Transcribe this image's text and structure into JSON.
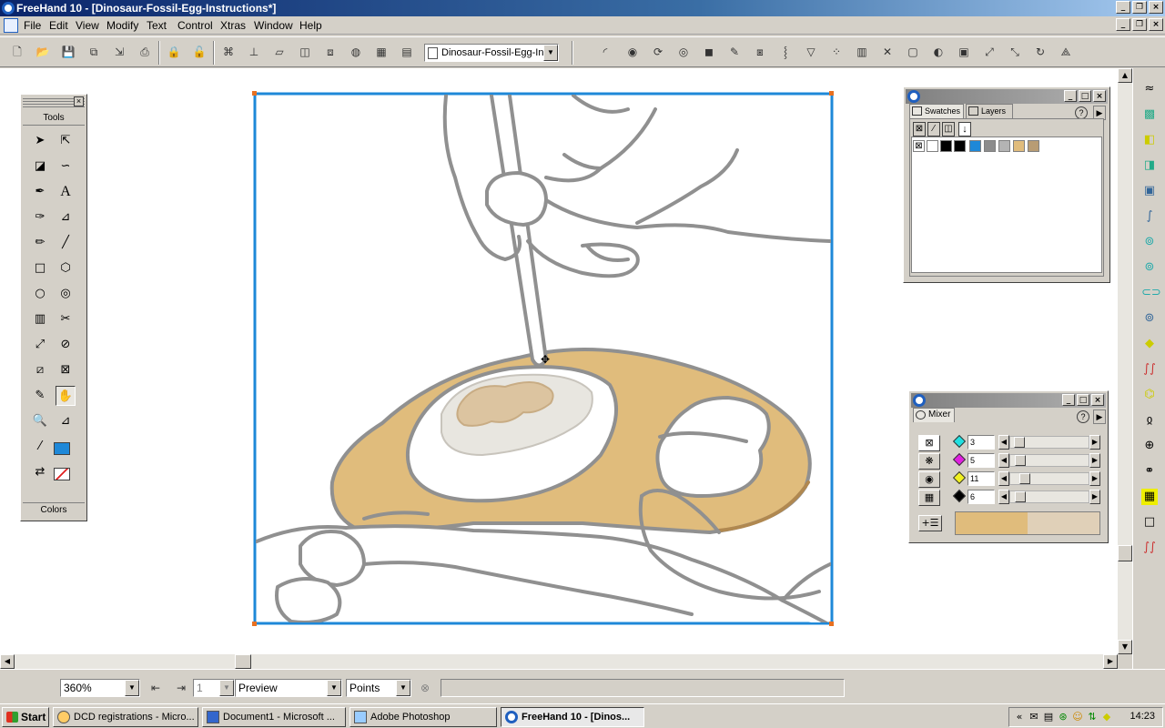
{
  "window": {
    "title": "FreeHand 10 - [Dinosaur-Fossil-Egg-Instructions*]"
  },
  "menu": [
    "File",
    "Edit",
    "View",
    "Modify",
    "Text",
    "Control",
    "Xtras",
    "Window",
    "Help"
  ],
  "toolbar": {
    "document_selector": "Dinosaur-Fossil-Egg-Inst"
  },
  "tools_panel": {
    "title": "Tools",
    "footer": "Colors",
    "fill_color": "#1e88d8"
  },
  "swatches_panel": {
    "tabs": [
      "Swatches",
      "Layers"
    ],
    "swatches": [
      "#ffffff",
      "#000000",
      "#000000",
      "#1e88d8",
      "#8c8c8c",
      "#b4b4b4",
      "#e0bc7c",
      "#b89c74"
    ]
  },
  "mixer_panel": {
    "tab": "Mixer",
    "cyan": "3",
    "magenta": "5",
    "yellow": "11",
    "black": "6",
    "new_color": "#e0bc7c",
    "old_color": "#e0d0b8"
  },
  "illustration": {
    "egg_color": "#e0bc7c",
    "outline_color": "#909090",
    "page_border": "#1e88d8"
  },
  "status": {
    "zoom": "360%",
    "page": "1",
    "view_mode": "Preview",
    "units": "Points"
  },
  "taskbar": {
    "start": "Start",
    "tasks": [
      "DCD registrations - Micro...",
      "Document1 - Microsoft ...",
      "Adobe Photoshop",
      "FreeHand 10 - [Dinos..."
    ],
    "clock": "14:23"
  }
}
